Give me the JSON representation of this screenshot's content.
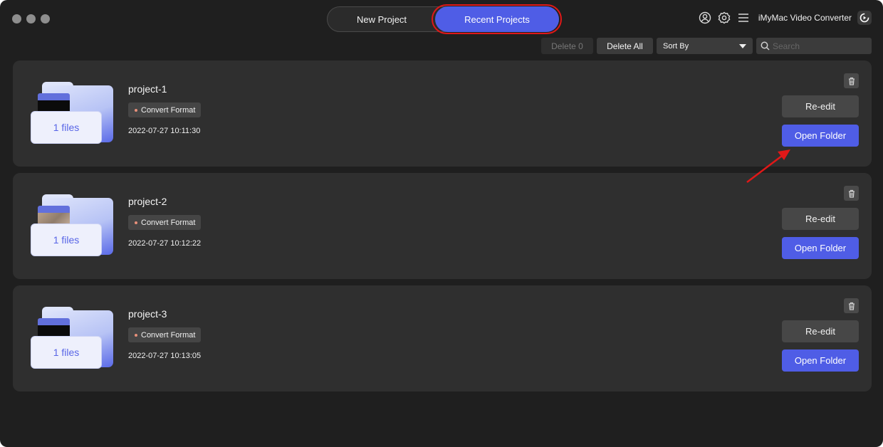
{
  "window": {
    "controls": [
      "close",
      "minimize",
      "zoom"
    ]
  },
  "header": {
    "tabs": [
      {
        "label": "New Project",
        "active": false
      },
      {
        "label": "Recent Projects",
        "active": true
      }
    ],
    "icons": [
      "user-icon",
      "gear-icon",
      "menu-icon"
    ],
    "app_title": "iMyMac Video Converter"
  },
  "toolbar": {
    "delete_selected_label": "Delete 0",
    "delete_all_label": "Delete All",
    "sort_label": "Sort By",
    "search_placeholder": "Search",
    "search_value": ""
  },
  "projects": [
    {
      "name": "project-1",
      "files_label": "1 files",
      "tag": "Convert Format",
      "date": "2022-07-27 10:11:30",
      "reedit_label": "Re-edit",
      "open_label": "Open Folder"
    },
    {
      "name": "project-2",
      "files_label": "1 files",
      "tag": "Convert Format",
      "date": "2022-07-27 10:12:22",
      "reedit_label": "Re-edit",
      "open_label": "Open Folder"
    },
    {
      "name": "project-3",
      "files_label": "1 files",
      "tag": "Convert Format",
      "date": "2022-07-27 10:13:05",
      "reedit_label": "Re-edit",
      "open_label": "Open Folder"
    }
  ],
  "colors": {
    "accent": "#4f5de6",
    "background": "#1f1f1f",
    "card": "#2f2f2f",
    "annotation": "#e01818"
  }
}
